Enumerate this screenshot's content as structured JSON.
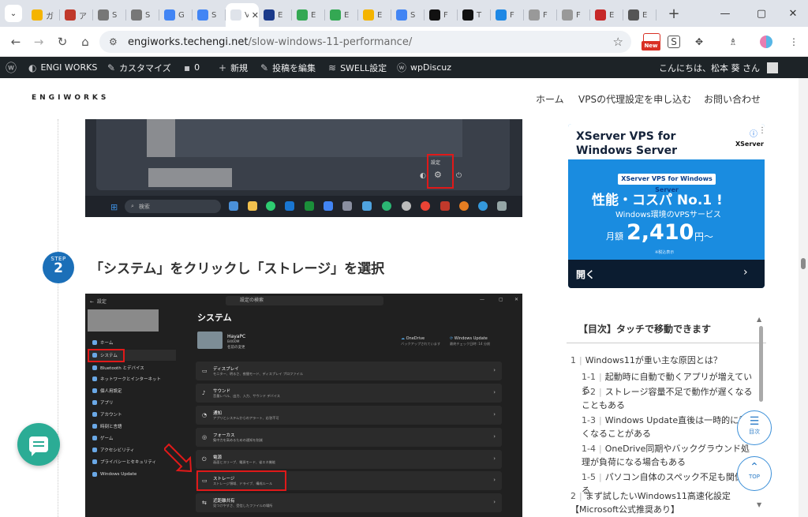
{
  "browser": {
    "tabs": [
      {
        "title": "ガ",
        "color": "#f4b400"
      },
      {
        "title": "ア",
        "color": "#c0392b"
      },
      {
        "title": "S",
        "color": "#777777"
      },
      {
        "title": "S",
        "color": "#777777"
      },
      {
        "title": "G",
        "color": "#4285f4"
      },
      {
        "title": "S",
        "color": "#4285f4"
      },
      {
        "title": "V",
        "color": "#ffffff",
        "active": true
      },
      {
        "title": "E",
        "color": "#1a3a8a"
      },
      {
        "title": "E",
        "color": "#34a853"
      },
      {
        "title": "E",
        "color": "#34a853"
      },
      {
        "title": "E",
        "color": "#f4b400"
      },
      {
        "title": "S",
        "color": "#4285f4"
      },
      {
        "title": "F",
        "color": "#111111"
      },
      {
        "title": "T",
        "color": "#111111"
      },
      {
        "title": "F",
        "color": "#1e88e5"
      },
      {
        "title": "F",
        "color": "#999999"
      },
      {
        "title": "F",
        "color": "#999999"
      },
      {
        "title": "E",
        "color": "#c62828"
      },
      {
        "title": "E",
        "color": "#555555"
      }
    ],
    "url_host": "engiworks.techengi.net",
    "url_path": "/slow-windows-11-performance/",
    "ext_new_badge": "New",
    "ext_s_label": "S"
  },
  "adminbar": {
    "site": "ENGI WORKS",
    "customize": "カスタマイズ",
    "comments": "0",
    "new": "新規",
    "edit": "投稿を編集",
    "swell": "SWELL設定",
    "wpdiscuz": "wpDiscuz",
    "greeting": "こんにちは、松本 葵 さん"
  },
  "header": {
    "logo": "ENGIWORKS",
    "nav": [
      "ホーム",
      "VPSの代理設定を申し込む",
      "お問い合わせ"
    ]
  },
  "shot1": {
    "settings_label": "設定",
    "search_text": "検索"
  },
  "step": {
    "label": "STEP",
    "number": "2",
    "title": "「システム」をクリックし「ストレージ」を選択"
  },
  "shot2": {
    "window_title": "設定",
    "search": "設定の検索",
    "page_title": "システム",
    "pc_name": "HayaPC",
    "pc_model": "B460M",
    "pc_rename": "名前の変更",
    "onedrive": "OneDrive",
    "onedrive_sub": "バックアップされています",
    "winupdate": "Windows Update",
    "winupdate_sub": "最終チェック日時: 14 分前",
    "sidebar": [
      "ホーム",
      "システム",
      "Bluetooth とデバイス",
      "ネットワークとインターネット",
      "個人用設定",
      "アプリ",
      "アカウント",
      "時刻と言語",
      "ゲーム",
      "アクセシビリティ",
      "プライバシーとセキュリティ",
      "Windows Update"
    ],
    "rows": [
      {
        "title": "ディスプレイ",
        "sub": "モニター、明るさ、夜間モード、ディスプレイ プロファイル",
        "icon": "▭"
      },
      {
        "title": "サウンド",
        "sub": "音量レベル、出力、入力、サウンド デバイス",
        "icon": "♪"
      },
      {
        "title": "通知",
        "sub": "アプリとシステムからのアラート、応答不可",
        "icon": "◔"
      },
      {
        "title": "フォーカス",
        "sub": "集中力を高めるための通知を削減",
        "icon": "◎"
      },
      {
        "title": "電源",
        "sub": "画面とスリープ、電源モード、省エネ機能",
        "icon": "⏻"
      },
      {
        "title": "ストレージ",
        "sub": "ストレージ領域、ドライブ、構成ルール",
        "icon": "▭"
      },
      {
        "title": "近距離共有",
        "sub": "見つけやすさ、受信したファイルの場所",
        "icon": "⇆"
      }
    ]
  },
  "ad": {
    "title": "XServer VPS for Windows Server",
    "brand": "XServer",
    "pill": "XServer VPS for Windows Server",
    "headline": "性能・コスパ No.1 !",
    "subhead": "Windows環境のVPSサービス",
    "price_label": "月額",
    "price": "2,410",
    "price_unit": "円〜",
    "tax": "※税込表示",
    "open": "開く"
  },
  "toc": {
    "title": "【目次】タッチで移動できます",
    "items": [
      {
        "n": "1",
        "text": "Windows11が重い主な原因とは？",
        "level": 1
      },
      {
        "n": "1-1",
        "text": "起動時に自動で動くアプリが増えている",
        "level": 2
      },
      {
        "n": "1-2",
        "text": "ストレージ容量不足で動作が遅くなることもある",
        "level": 2
      },
      {
        "n": "1-3",
        "text": "Windows Update直後は一時的に重くなることがある",
        "level": 2
      },
      {
        "n": "1-4",
        "text": "OneDrive同期やバックグラウンド処理が負荷になる場合もある",
        "level": 2
      },
      {
        "n": "1-5",
        "text": "パソコン自体のスペック不足も関係する",
        "level": 2
      },
      {
        "n": "2",
        "text": "まず試したいWindows11高速化設定【Microsoft公式推奨あり】",
        "level": 1
      }
    ]
  },
  "float": {
    "toc_label": "目次",
    "top_label": "TOP"
  }
}
